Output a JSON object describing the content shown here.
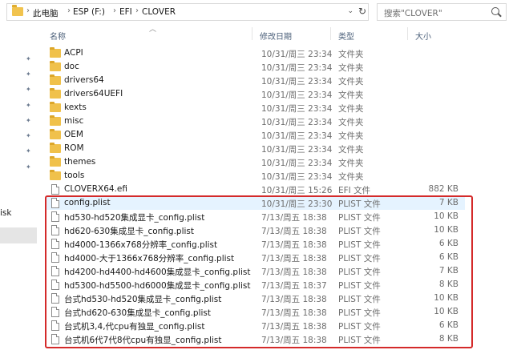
{
  "address_bar": {
    "path": [
      "此电脑",
      "ESP (F:)",
      "EFI",
      "CLOVER"
    ],
    "search_placeholder": "搜索\"CLOVER\""
  },
  "nav": {
    "partial_label": "isk"
  },
  "columns": {
    "name": "名称",
    "modified": "修改日期",
    "type": "类型",
    "size": "大小"
  },
  "files": [
    {
      "name": "ACPI",
      "date": "10/31/周三 23:34",
      "type": "文件夹",
      "size": "",
      "kind": "folder"
    },
    {
      "name": "doc",
      "date": "10/31/周三 23:34",
      "type": "文件夹",
      "size": "",
      "kind": "folder"
    },
    {
      "name": "drivers64",
      "date": "10/31/周三 23:34",
      "type": "文件夹",
      "size": "",
      "kind": "folder"
    },
    {
      "name": "drivers64UEFI",
      "date": "10/31/周三 23:34",
      "type": "文件夹",
      "size": "",
      "kind": "folder"
    },
    {
      "name": "kexts",
      "date": "10/31/周三 23:34",
      "type": "文件夹",
      "size": "",
      "kind": "folder"
    },
    {
      "name": "misc",
      "date": "10/31/周三 23:34",
      "type": "文件夹",
      "size": "",
      "kind": "folder"
    },
    {
      "name": "OEM",
      "date": "10/31/周三 23:34",
      "type": "文件夹",
      "size": "",
      "kind": "folder"
    },
    {
      "name": "ROM",
      "date": "10/31/周三 23:34",
      "type": "文件夹",
      "size": "",
      "kind": "folder"
    },
    {
      "name": "themes",
      "date": "10/31/周三 23:34",
      "type": "文件夹",
      "size": "",
      "kind": "folder"
    },
    {
      "name": "tools",
      "date": "10/31/周三 23:34",
      "type": "文件夹",
      "size": "",
      "kind": "folder"
    },
    {
      "name": "CLOVERX64.efi",
      "date": "10/31/周三 15:26",
      "type": "EFI 文件",
      "size": "882 KB",
      "kind": "file"
    },
    {
      "name": "config.plist",
      "date": "10/31/周三 23:30",
      "type": "PLIST 文件",
      "size": "7 KB",
      "kind": "file",
      "highlight": true
    },
    {
      "name": "hd530-hd520集成显卡_config.plist",
      "date": "7/13/周五 18:38",
      "type": "PLIST 文件",
      "size": "10 KB",
      "kind": "file"
    },
    {
      "name": "hd620-630集成显卡_config.plist",
      "date": "7/13/周五 18:38",
      "type": "PLIST 文件",
      "size": "10 KB",
      "kind": "file"
    },
    {
      "name": "hd4000-1366x768分辨率_config.plist",
      "date": "7/13/周五 18:38",
      "type": "PLIST 文件",
      "size": "6 KB",
      "kind": "file"
    },
    {
      "name": "hd4000-大于1366x768分辨率_config.plist",
      "date": "7/13/周五 18:38",
      "type": "PLIST 文件",
      "size": "6 KB",
      "kind": "file"
    },
    {
      "name": "hd4200-hd4400-hd4600集成显卡_config.plist",
      "date": "7/13/周五 18:38",
      "type": "PLIST 文件",
      "size": "7 KB",
      "kind": "file"
    },
    {
      "name": "hd5300-hd5500-hd6000集成显卡_config.plist",
      "date": "7/13/周五 18:37",
      "type": "PLIST 文件",
      "size": "8 KB",
      "kind": "file"
    },
    {
      "name": "台式hd530-hd520集成显卡_config.plist",
      "date": "7/13/周五 18:38",
      "type": "PLIST 文件",
      "size": "10 KB",
      "kind": "file"
    },
    {
      "name": "台式hd620-630集成显卡_config.plist",
      "date": "7/13/周五 18:38",
      "type": "PLIST 文件",
      "size": "10 KB",
      "kind": "file"
    },
    {
      "name": "台式机3,4,代cpu有独显_config.plist",
      "date": "7/13/周五 18:38",
      "type": "PLIST 文件",
      "size": "6 KB",
      "kind": "file"
    },
    {
      "name": "台式机6代7代8代cpu有独显_config.plist",
      "date": "7/13/周五 18:38",
      "type": "PLIST 文件",
      "size": "8 KB",
      "kind": "file"
    }
  ],
  "colors": {
    "highlight_box": "#d42a2a",
    "selected_row": "#e5f3ff",
    "folder": "#f0c14b"
  }
}
